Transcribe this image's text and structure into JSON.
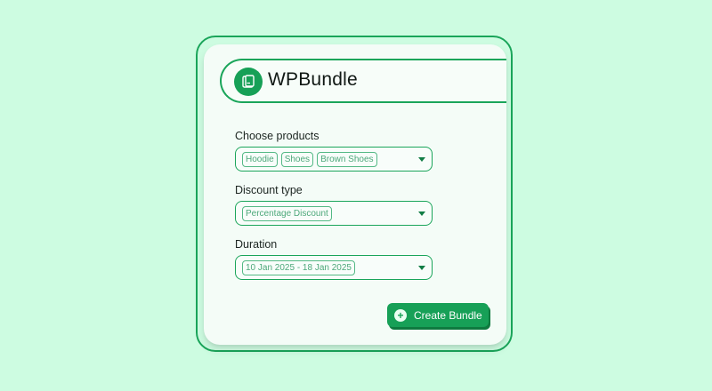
{
  "app": {
    "title": "WPBundle",
    "logo_icon": "box-icon",
    "accent_color": "#1aa55a",
    "background_color": "#cdfce1"
  },
  "form": {
    "products": {
      "label": "Choose products",
      "selected": [
        "Hoodie",
        "Shoes",
        "Brown Shoes"
      ]
    },
    "discount_type": {
      "label": "Discount type",
      "selected": "Percentage Discount"
    },
    "duration": {
      "label": "Duration",
      "selected": "10 Jan 2025 - 18 Jan 2025"
    }
  },
  "actions": {
    "create_label": "Create Bundle",
    "create_icon": "plus-icon"
  }
}
